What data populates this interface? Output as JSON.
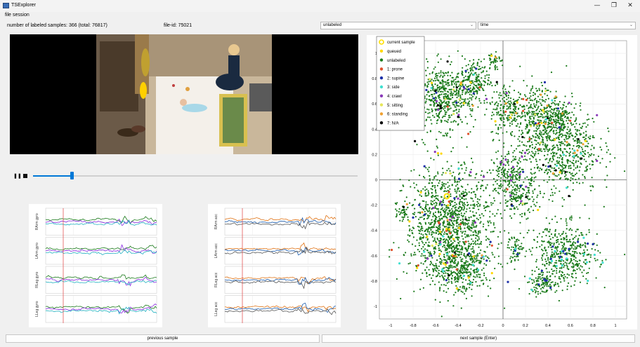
{
  "window": {
    "title": "TSExplorer",
    "minimize_icon": "minimize-icon",
    "maximize_icon": "restore-icon",
    "close_icon": "close-icon"
  },
  "menu": {
    "items": [
      "file",
      "session"
    ]
  },
  "info": {
    "labeled_samples": "number of labeled samples: 366 (total: 76817)",
    "file_id": "file-id: 75021"
  },
  "combos": {
    "label_filter": {
      "value": "unlabeled"
    },
    "sort_by": {
      "value": "time"
    }
  },
  "playback": {
    "pause_icon": "pause-icon",
    "stop_icon": "stop-icon",
    "position": 0.12
  },
  "sensors": {
    "left": {
      "labels": [
        "RArm gyro",
        "LArm gyro",
        "RLeg gyro",
        "LLeg gyro"
      ]
    },
    "right": {
      "labels": [
        "RArm acc",
        "LArm acc",
        "RLeg acc",
        "LLeg acc"
      ]
    }
  },
  "buttons": {
    "previous": "previous sample",
    "next": "next sample (Enter)"
  },
  "chart_data": {
    "type": "scatter",
    "xlim": [
      -1.1,
      1.1
    ],
    "ylim": [
      -1.1,
      1.1
    ],
    "xticks": [
      "-1",
      "-0.8",
      "-0.6",
      "-0.4",
      "-0.2",
      "0",
      "0.2",
      "0.4",
      "0.6",
      "0.8",
      "1"
    ],
    "yticks": [
      "1",
      "0.8",
      "0.6",
      "0.4",
      "0.2",
      "0",
      "-0.2",
      "-0.4",
      "-0.6",
      "-0.8",
      "-1"
    ],
    "grid": true,
    "legend_position": "top-left",
    "legend": [
      {
        "name": "current sample",
        "color": "#ffe000",
        "style": "ring"
      },
      {
        "name": "queued",
        "color": "#ffd700"
      },
      {
        "name": "unlabeled",
        "color": "#1a7a1a"
      },
      {
        "name": "1: prone",
        "color": "#e0502a"
      },
      {
        "name": "2: supine",
        "color": "#1c2fa8"
      },
      {
        "name": "3: side",
        "color": "#40e0d0"
      },
      {
        "name": "4: crawl",
        "color": "#8a3ab9"
      },
      {
        "name": "5: sitting",
        "color": "#e6e65a"
      },
      {
        "name": "6: standing",
        "color": "#f0a030"
      },
      {
        "name": "7: N/A",
        "color": "#000000"
      }
    ],
    "current_sample": {
      "x": -0.5,
      "y": -0.13
    },
    "clusters": [
      {
        "cx": -0.52,
        "cy": 0.65,
        "rx": 0.25,
        "ry": 0.23,
        "n": 520
      },
      {
        "cx": -0.27,
        "cy": 0.78,
        "rx": 0.14,
        "ry": 0.15,
        "n": 180
      },
      {
        "cx": 0.05,
        "cy": 0.55,
        "rx": 0.15,
        "ry": 0.2,
        "n": 200
      },
      {
        "cx": 0.3,
        "cy": 0.52,
        "rx": 0.15,
        "ry": 0.22,
        "n": 220
      },
      {
        "cx": 0.5,
        "cy": 0.25,
        "rx": 0.32,
        "ry": 0.33,
        "n": 650
      },
      {
        "cx": 0.5,
        "cy": 0.48,
        "rx": 0.12,
        "ry": 0.12,
        "n": 150
      },
      {
        "cx": 0.05,
        "cy": 0.05,
        "rx": 0.16,
        "ry": 0.15,
        "n": 200
      },
      {
        "cx": -0.48,
        "cy": -0.35,
        "rx": 0.35,
        "ry": 0.4,
        "n": 1200
      },
      {
        "cx": -0.38,
        "cy": -0.68,
        "rx": 0.25,
        "ry": 0.18,
        "n": 350
      },
      {
        "cx": 0.15,
        "cy": -0.15,
        "rx": 0.14,
        "ry": 0.14,
        "n": 140
      },
      {
        "cx": 0.55,
        "cy": -0.6,
        "rx": 0.27,
        "ry": 0.22,
        "n": 450
      },
      {
        "cx": 0.35,
        "cy": -0.82,
        "rx": 0.12,
        "ry": 0.08,
        "n": 90
      },
      {
        "cx": 0.1,
        "cy": -0.55,
        "rx": 0.08,
        "ry": 0.1,
        "n": 60
      },
      {
        "cx": -0.88,
        "cy": -0.25,
        "rx": 0.05,
        "ry": 0.06,
        "n": 30
      },
      {
        "cx": -0.08,
        "cy": 0.95,
        "rx": 0.05,
        "ry": 0.07,
        "n": 40
      }
    ]
  }
}
